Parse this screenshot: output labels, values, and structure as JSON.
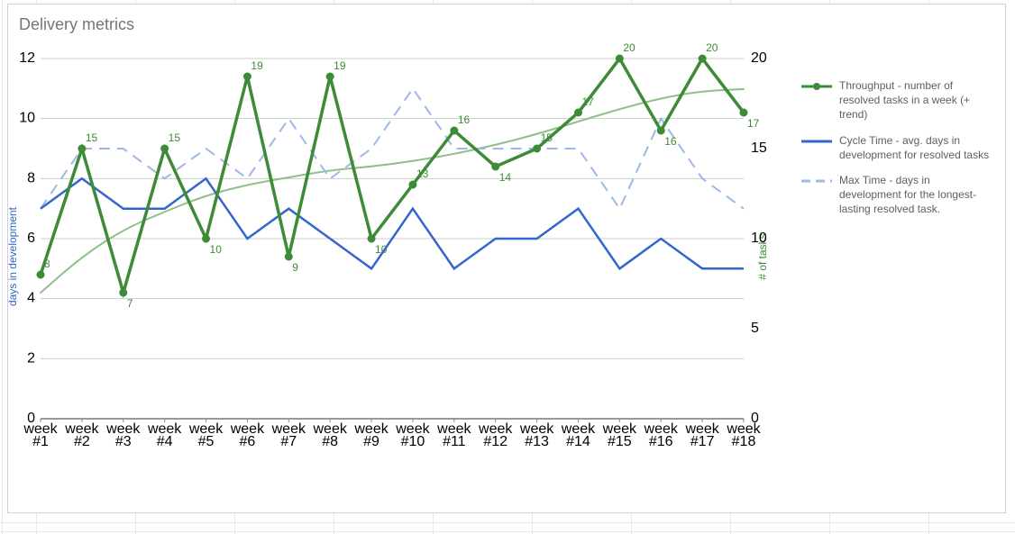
{
  "title": "Delivery metrics",
  "legend": {
    "throughput": "Throughput - number of resolved tasks in a week (+ trend)",
    "cycle": "Cycle Time - avg. days in development for resolved tasks",
    "max": "Max Time - days in development for the longest-lasting resolved task."
  },
  "axes": {
    "left_label": "days in development",
    "right_label": "# of tasks"
  },
  "colors": {
    "throughput": "#3d8b37",
    "cycle": "#3366cc",
    "max": "#9db8e6",
    "grid": "#cccccc",
    "axis": "#333333"
  },
  "chart_data": {
    "type": "line",
    "categories": [
      "week #1",
      "week #2",
      "week #3",
      "week #4",
      "week #5",
      "week #6",
      "week #7",
      "week #8",
      "week #9",
      "week #10",
      "week #11",
      "week #12",
      "week #13",
      "week #14",
      "week #15",
      "week #16",
      "week #17",
      "week #18"
    ],
    "left_axis": {
      "min": 0,
      "max": 12,
      "step": 2,
      "label": "days in development"
    },
    "right_axis": {
      "min": 0,
      "max": 20,
      "step": 5,
      "label": "# of tasks"
    },
    "series": [
      {
        "name": "Throughput - number of resolved tasks in a week (+ trend)",
        "axis": "right",
        "style": "thick-line-dots",
        "color": "#3d8b37",
        "values": [
          8,
          15,
          7,
          15,
          10,
          19,
          9,
          19,
          10,
          13,
          16,
          14,
          15,
          17,
          20,
          16,
          20,
          17
        ],
        "data_labels": [
          8,
          15,
          7,
          15,
          10,
          19,
          9,
          19,
          10,
          13,
          16,
          14,
          15,
          17,
          20,
          16,
          20,
          17
        ]
      },
      {
        "name": "Throughput trend",
        "axis": "right",
        "style": "smooth-trend",
        "color": "#8fc08a",
        "values": [
          7,
          9,
          10.5,
          11.5,
          12.4,
          13.0,
          13.4,
          13.8,
          14.0,
          14.3,
          14.7,
          15.2,
          15.8,
          16.5,
          17.2,
          17.8,
          18.2,
          18.3
        ]
      },
      {
        "name": "Cycle Time - avg. days in development for resolved tasks",
        "axis": "left",
        "style": "solid-line",
        "color": "#3366cc",
        "values": [
          7,
          8,
          7,
          7,
          8,
          6,
          7,
          6,
          5,
          7,
          5,
          6,
          6,
          7,
          5,
          6,
          5,
          5
        ]
      },
      {
        "name": "Max Time - days in development for the longest-lasting resolved task.",
        "axis": "left",
        "style": "dashed-line",
        "color": "#9db8e6",
        "values": [
          7,
          9,
          9,
          8,
          9,
          8,
          10,
          8,
          9,
          11,
          9,
          9,
          9,
          9,
          7,
          10,
          8,
          7
        ]
      }
    ]
  }
}
